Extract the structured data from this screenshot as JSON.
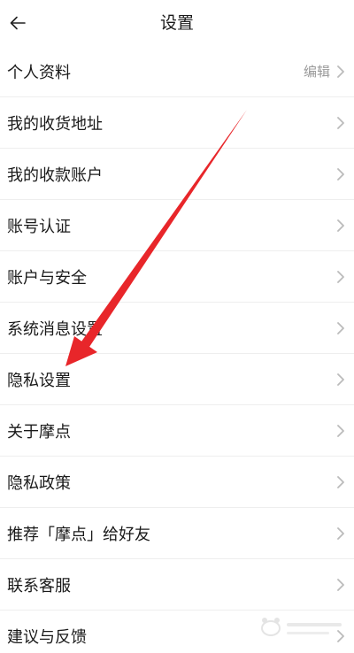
{
  "header": {
    "title": "设置"
  },
  "settings": {
    "items": [
      {
        "label": "个人资料",
        "value": "编辑"
      },
      {
        "label": "我的收货地址"
      },
      {
        "label": "我的收款账户"
      },
      {
        "label": "账号认证"
      },
      {
        "label": "账户与安全"
      },
      {
        "label": "系统消息设置"
      },
      {
        "label": "隐私设置"
      },
      {
        "label": "关于摩点"
      },
      {
        "label": "隐私政策"
      },
      {
        "label": "推荐「摩点」给好友"
      },
      {
        "label": "联系客服"
      },
      {
        "label": "建议与反馈"
      }
    ]
  },
  "icons": {
    "back": "arrow-left-icon",
    "chevron": "chevron-right-icon"
  },
  "colors": {
    "annotation_arrow": "#e8262a",
    "chevron": "#bbbbbb",
    "secondary_text": "#999999"
  }
}
